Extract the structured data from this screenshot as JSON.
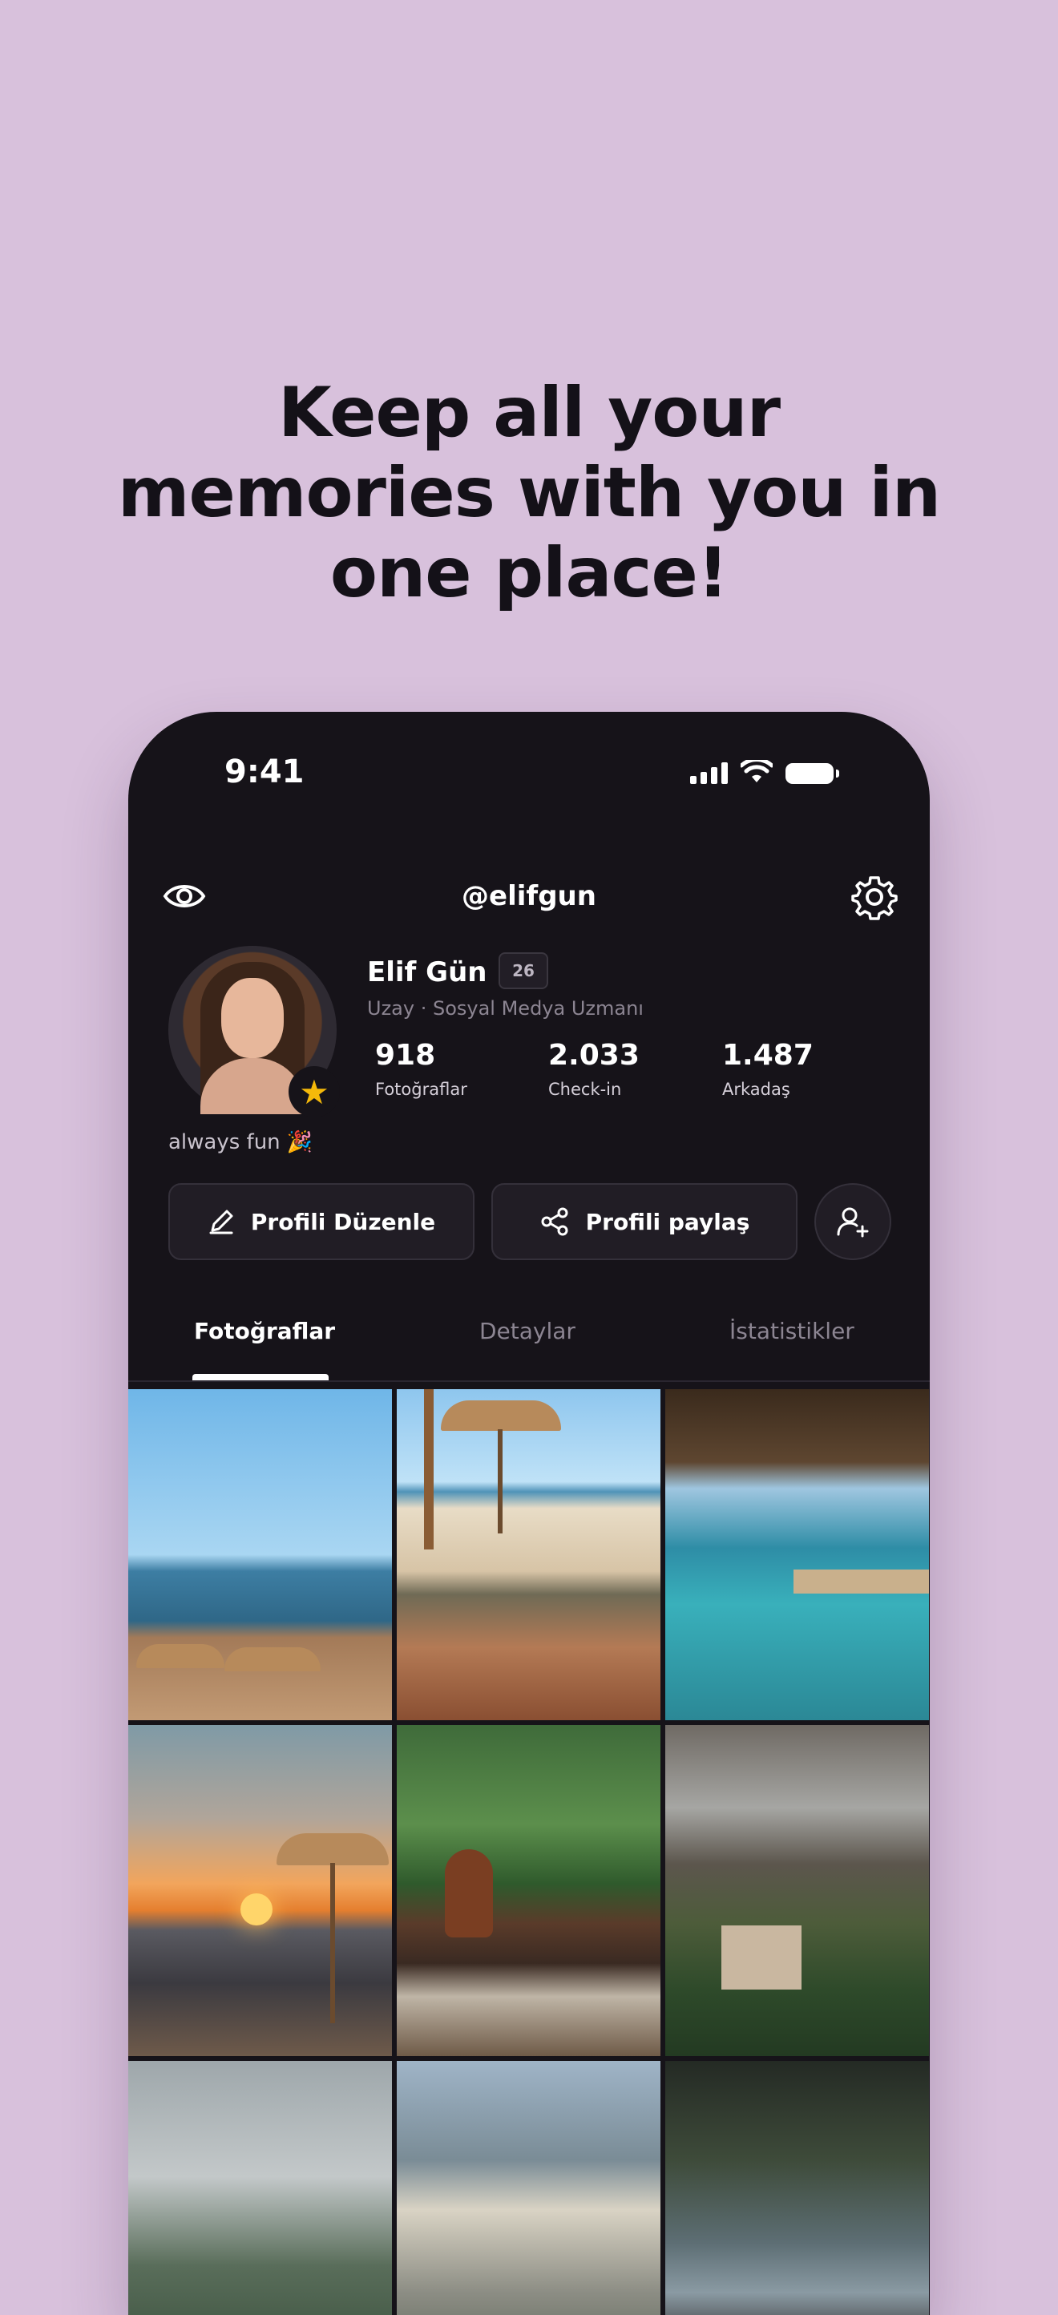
{
  "headline": [
    "Keep all your",
    "memories with you in",
    "one place!"
  ],
  "status_bar": {
    "time": "9:41"
  },
  "topbar": {
    "handle": "@elifgun"
  },
  "profile": {
    "name": "Elif Gün",
    "age_badge": "26",
    "subtitle": "Uzay · Sosyal Medya Uzmanı",
    "bio": "always fun 🎉",
    "stats": [
      {
        "value": "918",
        "label": "Fotoğraflar"
      },
      {
        "value": "2.033",
        "label": "Check-in"
      },
      {
        "value": "1.487",
        "label": "Arkadaş"
      }
    ]
  },
  "actions": {
    "edit_label": "Profili Düzenle",
    "share_label": "Profili paylaş"
  },
  "tabs": [
    {
      "label": "Fotoğraflar",
      "active": true
    },
    {
      "label": "Detaylar",
      "active": false
    },
    {
      "label": "İstatistikler",
      "active": false
    }
  ],
  "colors": {
    "background": "#d8c1dc",
    "phone_bg": "#161319",
    "star": "#f5b90a"
  },
  "icons": [
    "eye-icon",
    "gear-icon",
    "pencil-icon",
    "share-icon",
    "add-user-icon",
    "star-icon",
    "signal-icon",
    "wifi-icon",
    "battery-icon"
  ]
}
